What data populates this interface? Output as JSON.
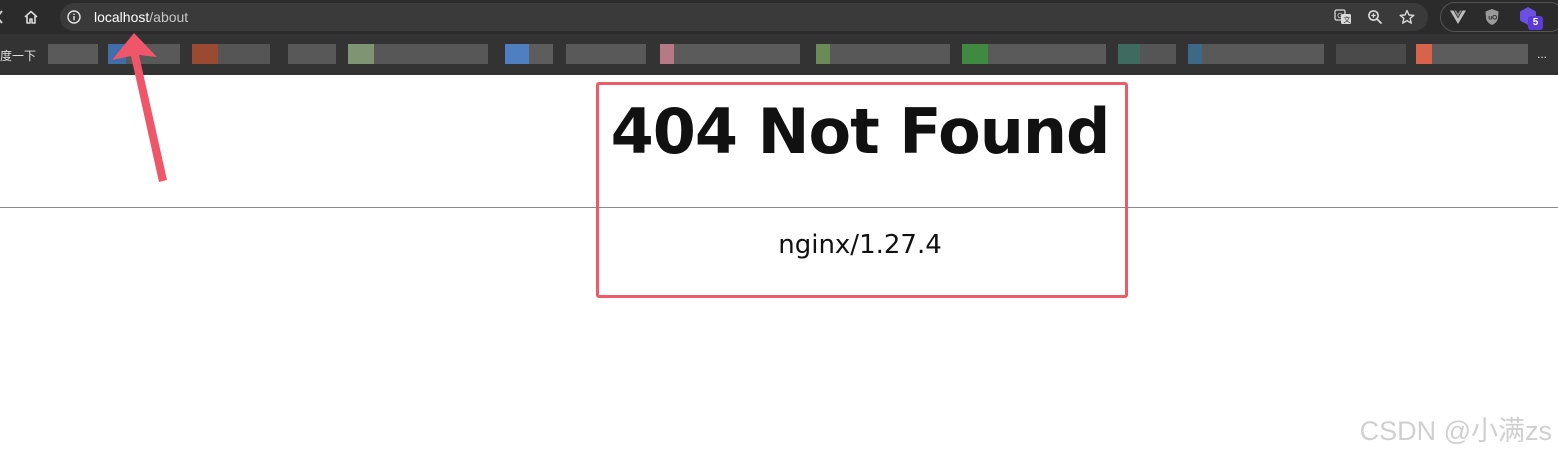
{
  "browser": {
    "address_bar": {
      "host": "localhost",
      "path": "/about"
    },
    "extensions": {
      "tab_badge_count": "5"
    },
    "bookmarks": {
      "first_label_partial": "度一下",
      "overflow": "..."
    },
    "colors": {
      "toolbar_bg": "#2b2b2b",
      "bookmarks_bg": "#333333",
      "omnibox_bg": "#3a3a3a"
    }
  },
  "page": {
    "title": "404 Not Found",
    "server": "nginx/1.27.4"
  },
  "annotation": {
    "color": "#ee5a6a"
  },
  "watermark": {
    "text": "CSDN @小满zs"
  },
  "icons": [
    "back-icon",
    "home-icon",
    "info-icon",
    "translate-icon",
    "zoom-icon",
    "star-icon",
    "vue-devtools-icon",
    "ublock-icon",
    "tab-manager-icon"
  ]
}
